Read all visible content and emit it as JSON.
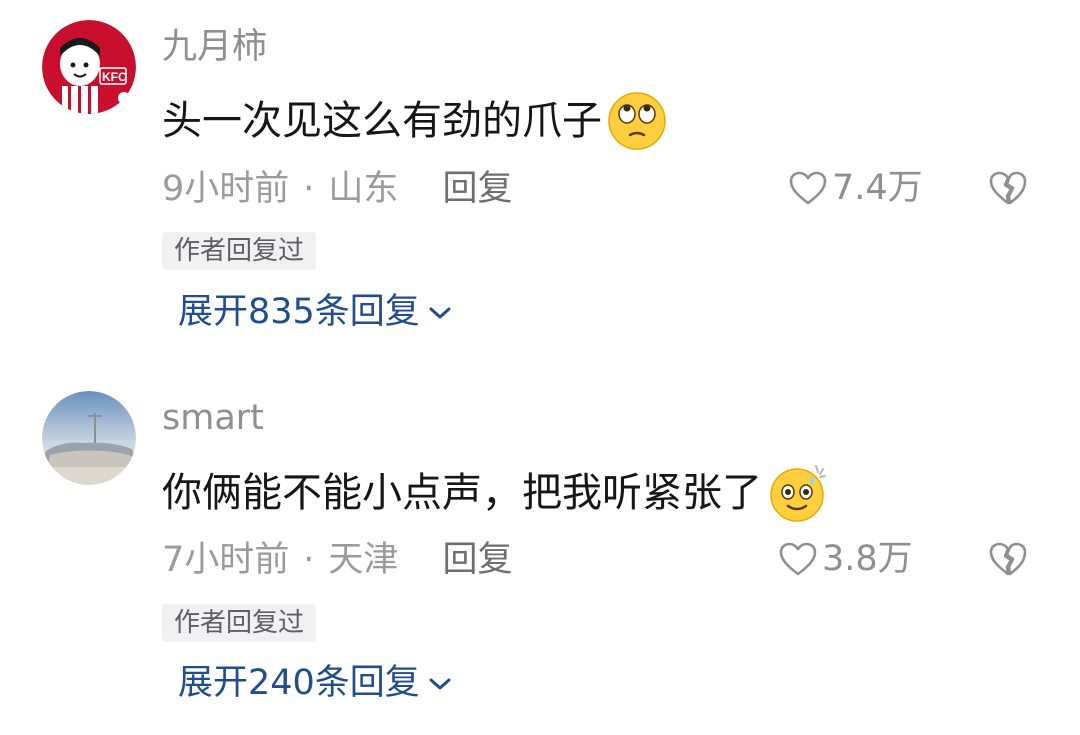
{
  "comments": [
    {
      "username": "九月柿",
      "text": "头一次见这么有劲的爪子",
      "emoji": "eye-roll-emoji",
      "time": "9小时前",
      "location": "山东",
      "reply_label": "回复",
      "likes": "7.4万",
      "author_tag": "作者回复过",
      "expand_label": "展开835条回复",
      "avatar": "kfc-avatar"
    },
    {
      "username": "smart",
      "text": "你俩能不能小点声，把我听紧张了",
      "emoji": "nervous-sweat-emoji",
      "time": "7小时前",
      "location": "天津",
      "reply_label": "回复",
      "likes": "3.8万",
      "author_tag": "作者回复过",
      "expand_label": "展开240条回复",
      "avatar": "landscape-avatar"
    }
  ],
  "colors": {
    "link": "#1f4d8f",
    "meta": "#9b9b9f",
    "kfc_red": "#c8102e"
  }
}
